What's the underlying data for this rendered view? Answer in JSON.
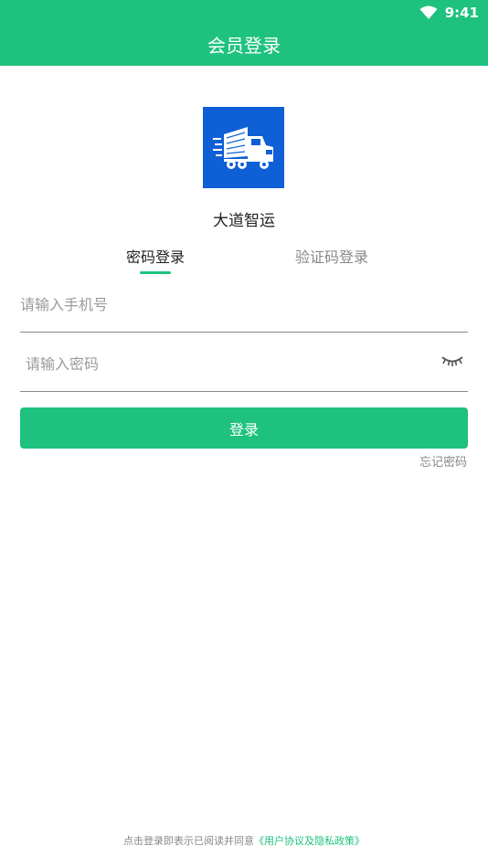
{
  "status_bar": {
    "time": "9:41",
    "wifi_icon": "wifi-icon"
  },
  "header": {
    "title": "会员登录"
  },
  "app": {
    "name": "大道智运",
    "logo_icon": "truck-icon",
    "logo_color": "#0f5fd6"
  },
  "tabs": [
    {
      "label": "密码登录",
      "active": true
    },
    {
      "label": "验证码登录",
      "active": false
    }
  ],
  "form": {
    "phone_placeholder": "请输入手机号",
    "password_placeholder": "请输入密码",
    "password_toggle_icon": "eye-closed-icon",
    "login_label": "登录",
    "forgot_label": "忘记密码"
  },
  "agreement": {
    "text": "点击登录即表示已阅读并同意",
    "link": "《用户协议及隐私政策》"
  },
  "colors": {
    "brand_green": "#1ec27e",
    "logo_blue": "#0f5fd6"
  }
}
